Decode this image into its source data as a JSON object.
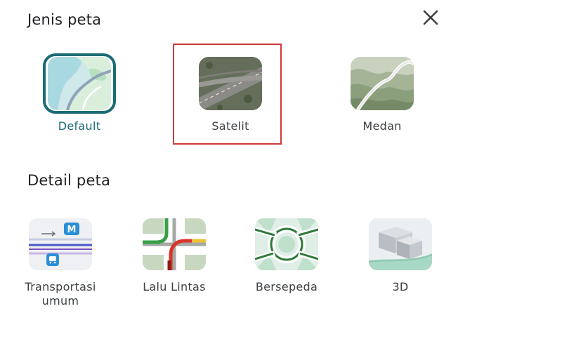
{
  "header": {
    "map_type_title": "Jenis peta",
    "close_icon": "close-icon"
  },
  "map_types": [
    {
      "label": "Default",
      "icon": "default-map-thumbnail",
      "selected": true
    },
    {
      "label": "Satelit",
      "icon": "satellite-map-thumbnail",
      "selected": false
    },
    {
      "label": "Medan",
      "icon": "terrain-map-thumbnail",
      "selected": false
    }
  ],
  "details": {
    "title": "Detail peta",
    "items": [
      {
        "label_line1": "Transportasi",
        "label_line2": "umum",
        "icon": "transit-thumbnail"
      },
      {
        "label_line1": "Lalu Lintas",
        "label_line2": "",
        "icon": "traffic-thumbnail"
      },
      {
        "label_line1": "Bersepeda",
        "label_line2": "",
        "icon": "biking-thumbnail"
      },
      {
        "label_line1": "3D",
        "label_line2": "",
        "icon": "3d-thumbnail"
      }
    ]
  },
  "colors": {
    "selected_accent": "#1a6b73",
    "highlight_annotation": "#d03a3a"
  }
}
